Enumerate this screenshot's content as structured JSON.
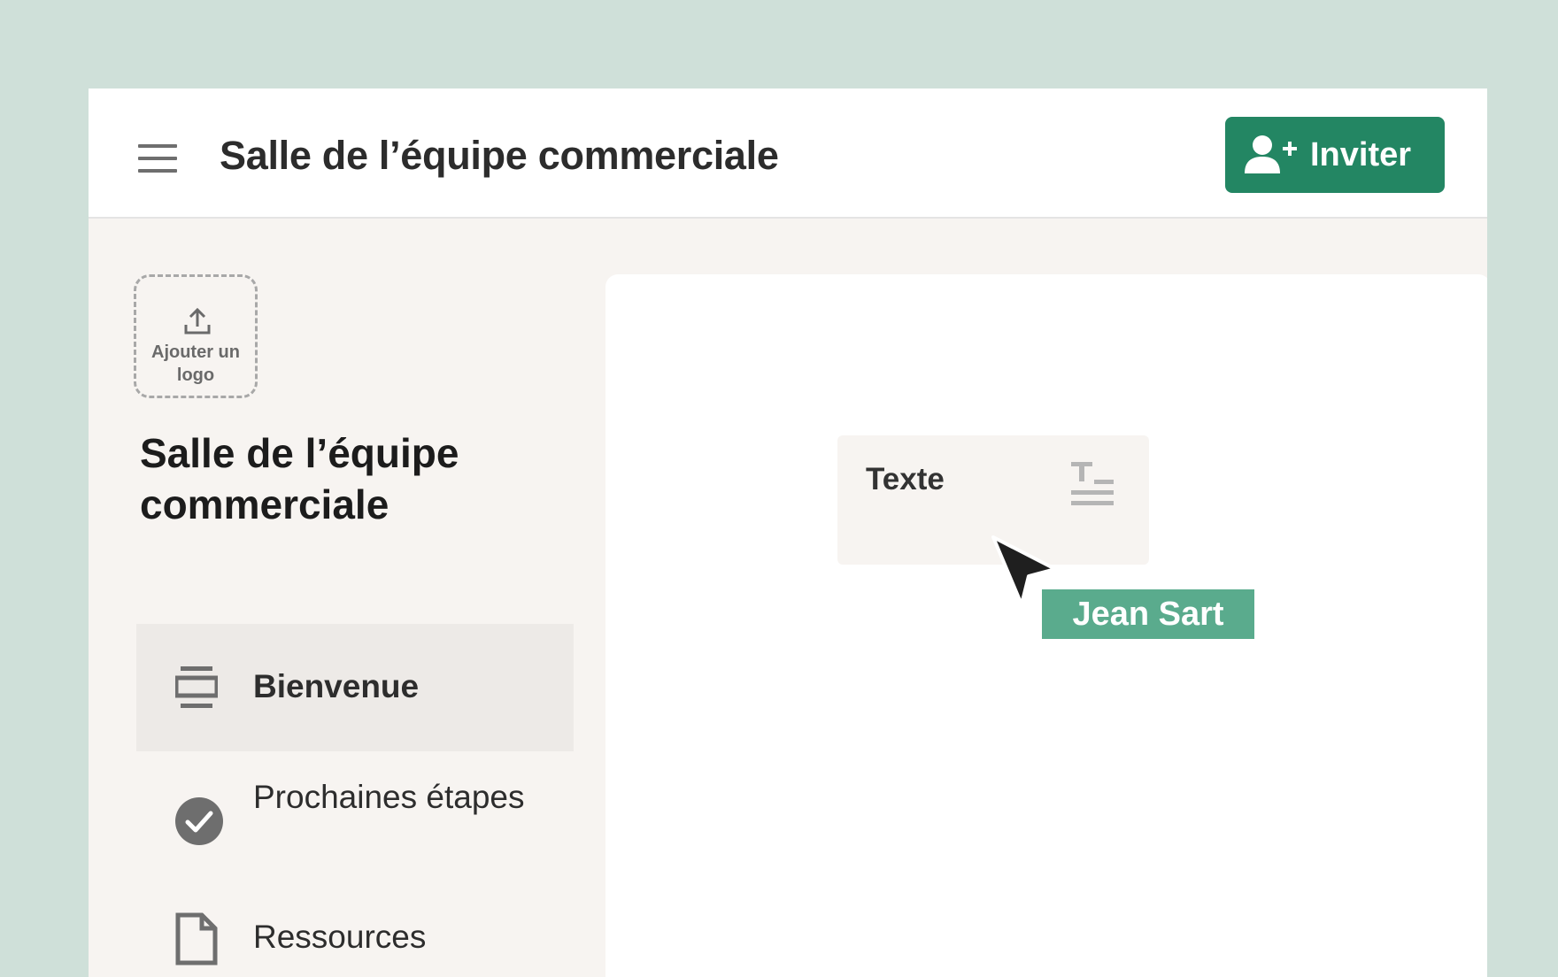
{
  "header": {
    "title": "Salle de l’équipe commerciale",
    "invite_label": "Inviter"
  },
  "sidebar": {
    "logo_upload_label": "Ajouter un logo",
    "title": "Salle de l’équipe commerciale",
    "items": [
      {
        "label": "Bienvenue",
        "icon": "welcome-page-icon",
        "active": true
      },
      {
        "label": "Prochaines étapes",
        "icon": "check-circle-icon",
        "active": false
      },
      {
        "label": "Ressources",
        "icon": "document-icon",
        "active": false
      }
    ]
  },
  "content": {
    "text_block_label": "Texte",
    "text_block_icon": "text-format-icon",
    "collaborator_name": "Jean Sart"
  },
  "colors": {
    "background": "#cfe0d9",
    "accent": "#238663",
    "collaborator_tag": "#5aab8d",
    "sidebar_bg": "#f7f4f1"
  }
}
